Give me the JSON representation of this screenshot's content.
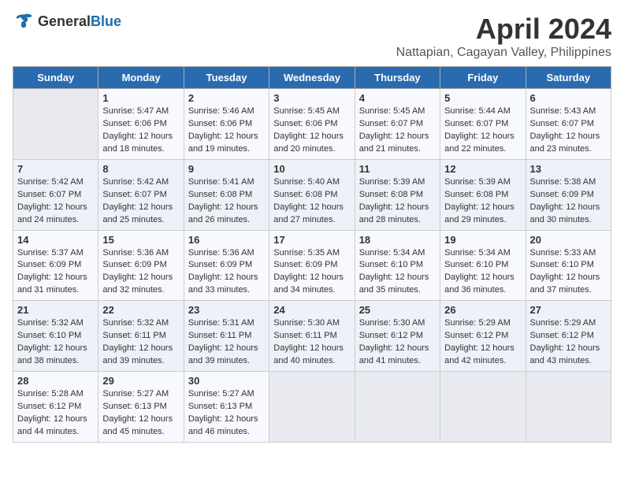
{
  "header": {
    "logo_general": "General",
    "logo_blue": "Blue",
    "title": "April 2024",
    "location": "Nattapian, Cagayan Valley, Philippines"
  },
  "days_of_week": [
    "Sunday",
    "Monday",
    "Tuesday",
    "Wednesday",
    "Thursday",
    "Friday",
    "Saturday"
  ],
  "weeks": [
    [
      {
        "day": "",
        "content": ""
      },
      {
        "day": "1",
        "content": "Sunrise: 5:47 AM\nSunset: 6:06 PM\nDaylight: 12 hours\nand 18 minutes."
      },
      {
        "day": "2",
        "content": "Sunrise: 5:46 AM\nSunset: 6:06 PM\nDaylight: 12 hours\nand 19 minutes."
      },
      {
        "day": "3",
        "content": "Sunrise: 5:45 AM\nSunset: 6:06 PM\nDaylight: 12 hours\nand 20 minutes."
      },
      {
        "day": "4",
        "content": "Sunrise: 5:45 AM\nSunset: 6:07 PM\nDaylight: 12 hours\nand 21 minutes."
      },
      {
        "day": "5",
        "content": "Sunrise: 5:44 AM\nSunset: 6:07 PM\nDaylight: 12 hours\nand 22 minutes."
      },
      {
        "day": "6",
        "content": "Sunrise: 5:43 AM\nSunset: 6:07 PM\nDaylight: 12 hours\nand 23 minutes."
      }
    ],
    [
      {
        "day": "7",
        "content": "Sunrise: 5:42 AM\nSunset: 6:07 PM\nDaylight: 12 hours\nand 24 minutes."
      },
      {
        "day": "8",
        "content": "Sunrise: 5:42 AM\nSunset: 6:07 PM\nDaylight: 12 hours\nand 25 minutes."
      },
      {
        "day": "9",
        "content": "Sunrise: 5:41 AM\nSunset: 6:08 PM\nDaylight: 12 hours\nand 26 minutes."
      },
      {
        "day": "10",
        "content": "Sunrise: 5:40 AM\nSunset: 6:08 PM\nDaylight: 12 hours\nand 27 minutes."
      },
      {
        "day": "11",
        "content": "Sunrise: 5:39 AM\nSunset: 6:08 PM\nDaylight: 12 hours\nand 28 minutes."
      },
      {
        "day": "12",
        "content": "Sunrise: 5:39 AM\nSunset: 6:08 PM\nDaylight: 12 hours\nand 29 minutes."
      },
      {
        "day": "13",
        "content": "Sunrise: 5:38 AM\nSunset: 6:09 PM\nDaylight: 12 hours\nand 30 minutes."
      }
    ],
    [
      {
        "day": "14",
        "content": "Sunrise: 5:37 AM\nSunset: 6:09 PM\nDaylight: 12 hours\nand 31 minutes."
      },
      {
        "day": "15",
        "content": "Sunrise: 5:36 AM\nSunset: 6:09 PM\nDaylight: 12 hours\nand 32 minutes."
      },
      {
        "day": "16",
        "content": "Sunrise: 5:36 AM\nSunset: 6:09 PM\nDaylight: 12 hours\nand 33 minutes."
      },
      {
        "day": "17",
        "content": "Sunrise: 5:35 AM\nSunset: 6:09 PM\nDaylight: 12 hours\nand 34 minutes."
      },
      {
        "day": "18",
        "content": "Sunrise: 5:34 AM\nSunset: 6:10 PM\nDaylight: 12 hours\nand 35 minutes."
      },
      {
        "day": "19",
        "content": "Sunrise: 5:34 AM\nSunset: 6:10 PM\nDaylight: 12 hours\nand 36 minutes."
      },
      {
        "day": "20",
        "content": "Sunrise: 5:33 AM\nSunset: 6:10 PM\nDaylight: 12 hours\nand 37 minutes."
      }
    ],
    [
      {
        "day": "21",
        "content": "Sunrise: 5:32 AM\nSunset: 6:10 PM\nDaylight: 12 hours\nand 38 minutes."
      },
      {
        "day": "22",
        "content": "Sunrise: 5:32 AM\nSunset: 6:11 PM\nDaylight: 12 hours\nand 39 minutes."
      },
      {
        "day": "23",
        "content": "Sunrise: 5:31 AM\nSunset: 6:11 PM\nDaylight: 12 hours\nand 39 minutes."
      },
      {
        "day": "24",
        "content": "Sunrise: 5:30 AM\nSunset: 6:11 PM\nDaylight: 12 hours\nand 40 minutes."
      },
      {
        "day": "25",
        "content": "Sunrise: 5:30 AM\nSunset: 6:12 PM\nDaylight: 12 hours\nand 41 minutes."
      },
      {
        "day": "26",
        "content": "Sunrise: 5:29 AM\nSunset: 6:12 PM\nDaylight: 12 hours\nand 42 minutes."
      },
      {
        "day": "27",
        "content": "Sunrise: 5:29 AM\nSunset: 6:12 PM\nDaylight: 12 hours\nand 43 minutes."
      }
    ],
    [
      {
        "day": "28",
        "content": "Sunrise: 5:28 AM\nSunset: 6:12 PM\nDaylight: 12 hours\nand 44 minutes."
      },
      {
        "day": "29",
        "content": "Sunrise: 5:27 AM\nSunset: 6:13 PM\nDaylight: 12 hours\nand 45 minutes."
      },
      {
        "day": "30",
        "content": "Sunrise: 5:27 AM\nSunset: 6:13 PM\nDaylight: 12 hours\nand 46 minutes."
      },
      {
        "day": "",
        "content": ""
      },
      {
        "day": "",
        "content": ""
      },
      {
        "day": "",
        "content": ""
      },
      {
        "day": "",
        "content": ""
      }
    ]
  ]
}
